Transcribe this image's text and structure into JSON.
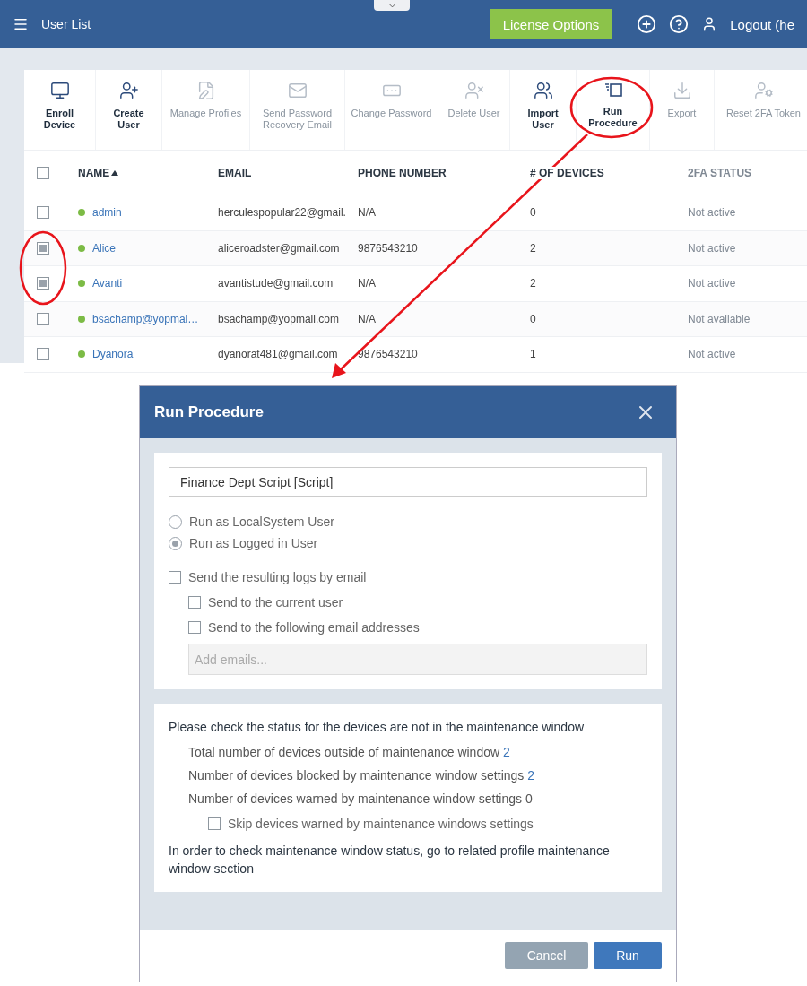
{
  "header": {
    "title": "User List",
    "license_button": "License Options",
    "logout": "Logout (he"
  },
  "toolbar": [
    {
      "label": "Enroll Device",
      "disabled": false
    },
    {
      "label": "Create User",
      "disabled": false
    },
    {
      "label": "Manage Profiles",
      "disabled": true
    },
    {
      "label": "Send Password Recovery Email",
      "disabled": true
    },
    {
      "label": "Change Password",
      "disabled": true
    },
    {
      "label": "Delete User",
      "disabled": true
    },
    {
      "label": "Import User",
      "disabled": false
    },
    {
      "label": "Run Procedure",
      "disabled": false
    },
    {
      "label": "Export",
      "disabled": true
    },
    {
      "label": "Reset 2FA Token",
      "disabled": true
    }
  ],
  "table": {
    "all_checked": false,
    "columns": [
      {
        "label": "NAME",
        "sorted": true
      },
      {
        "label": "EMAIL",
        "sorted": false
      },
      {
        "label": "PHONE NUMBER",
        "sorted": false
      },
      {
        "label": "# OF DEVICES",
        "sorted": false
      },
      {
        "label": "2FA STATUS",
        "sorted": false
      }
    ],
    "rows": [
      {
        "name": "admin",
        "email": "herculespopular22@gmail.",
        "phone": "N/A",
        "devices": "0",
        "twofa": "Not active",
        "checked": false
      },
      {
        "name": "Alice",
        "email": "aliceroadster@gmail.com",
        "phone": "9876543210",
        "devices": "2",
        "twofa": "Not active",
        "checked": true
      },
      {
        "name": "Avanti",
        "email": "avantistude@gmail.com",
        "phone": "N/A",
        "devices": "2",
        "twofa": "Not active",
        "checked": true
      },
      {
        "name": "bsachamp@yopmai…",
        "email": "bsachamp@yopmail.com",
        "phone": "N/A",
        "devices": "0",
        "twofa": "Not available",
        "checked": false
      },
      {
        "name": "Dyanora",
        "email": "dyanorat481@gmail.com",
        "phone": "9876543210",
        "devices": "1",
        "twofa": "Not active",
        "checked": false
      }
    ]
  },
  "dialog": {
    "title": "Run Procedure",
    "procedure": "Finance Dept Script [Script]",
    "run_as": [
      {
        "label": "Run as LocalSystem User",
        "selected": false
      },
      {
        "label": "Run as Logged in User",
        "selected": true
      }
    ],
    "send_logs": {
      "label": "Send the resulting logs by email",
      "checked": false
    },
    "send_options": [
      {
        "label": "Send to the current user",
        "checked": false
      },
      {
        "label": "Send to the following email addresses",
        "checked": false
      }
    ],
    "emails_placeholder": "Add emails...",
    "maintenance_intro": "Please check the status for the devices are not in the maintenance window",
    "stats": [
      {
        "label": "Total number of devices outside of maintenance window",
        "value": "2",
        "link": true
      },
      {
        "label": "Number of devices blocked by maintenance window settings",
        "value": "2",
        "link": true
      },
      {
        "label": "Number of devices warned by maintenance window settings",
        "value": "0",
        "link": false
      }
    ],
    "skip": {
      "label": "Skip devices warned by maintenance windows settings",
      "checked": false
    },
    "note": "In order to check maintenance window status, go to related profile maintenance window section",
    "buttons": {
      "cancel": "Cancel",
      "run": "Run"
    }
  }
}
